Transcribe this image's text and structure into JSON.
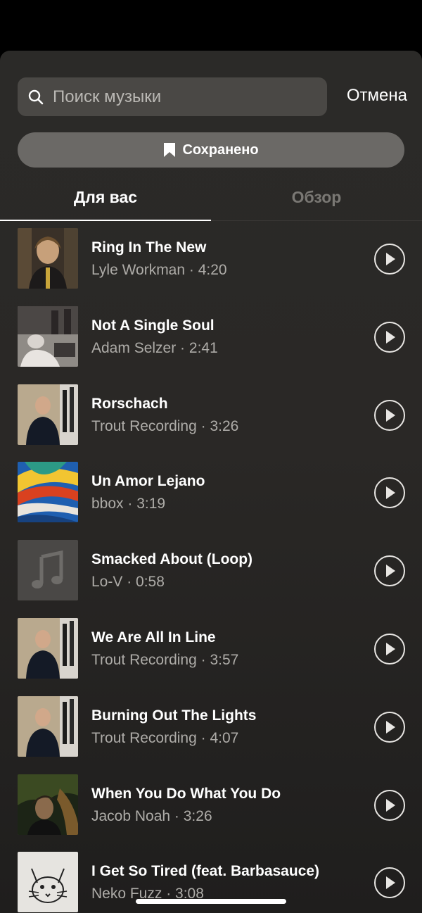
{
  "search": {
    "placeholder": "Поиск музыки",
    "cancel_label": "Отмена"
  },
  "saved": {
    "label": "Сохранено"
  },
  "tabs": [
    {
      "label": "Для вас",
      "active": true
    },
    {
      "label": "Обзор",
      "active": false
    }
  ],
  "tracks": [
    {
      "title": "Ring In The New",
      "artist": "Lyle Workman",
      "duration": "4:20"
    },
    {
      "title": "Not A Single Soul",
      "artist": "Adam Selzer",
      "duration": "2:41"
    },
    {
      "title": "Rorschach",
      "artist": "Trout Recording",
      "duration": "3:26"
    },
    {
      "title": "Un Amor Lejano",
      "artist": "bbox",
      "duration": "3:19"
    },
    {
      "title": "Smacked About (Loop)",
      "artist": "Lo-V",
      "duration": "0:58"
    },
    {
      "title": "We Are All In Line",
      "artist": "Trout Recording",
      "duration": "3:57"
    },
    {
      "title": "Burning Out The Lights",
      "artist": "Trout Recording",
      "duration": "4:07"
    },
    {
      "title": "When You Do What You Do",
      "artist": "Jacob Noah",
      "duration": "3:26"
    },
    {
      "title": "I Get So Tired (feat. Barbasauce)",
      "artist": "Neko Fuzz",
      "duration": "3:08"
    }
  ],
  "meta_separator": " · ",
  "colors": {
    "background": "#2a2826",
    "accent": "#ffffff",
    "secondary_text": "#aeaca8",
    "inactive_tab": "#7a7874"
  }
}
